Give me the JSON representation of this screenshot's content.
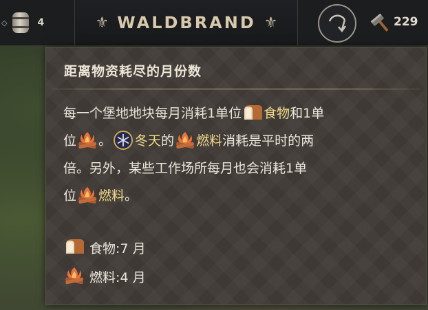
{
  "topbar": {
    "left_resource_count": "4",
    "title": "WALDBRAND",
    "right_resource_count": "229"
  },
  "tooltip": {
    "title": "距离物资耗尽的月份数",
    "line1_a": "每一个堡地地块每月消耗1单位",
    "food_label": "食物",
    "line1_b": "和1单",
    "line2_a": "位",
    "line2_b": "。",
    "winter_label": "冬天",
    "line2_c": "的",
    "fuel_label": "燃料",
    "line2_d": "消耗是平时的两",
    "line3": "倍。另外，某些工作场所每月也会消耗1单",
    "line4_a": "位",
    "line4_fuel": "燃料",
    "line4_b": "。",
    "stat_food": "食物:7 月",
    "stat_fuel": "燃料:4 月"
  },
  "icons": [
    "barrel-icon",
    "fleur-de-lis-icon",
    "cycle-arrow-icon",
    "hammer-icon",
    "bread-icon",
    "campfire-icon",
    "snowflake-icon"
  ],
  "colors": {
    "highlight": "#f3d98b",
    "text": "#ece6dc",
    "panel": "#403b36",
    "divider": "#c4aa7e"
  }
}
